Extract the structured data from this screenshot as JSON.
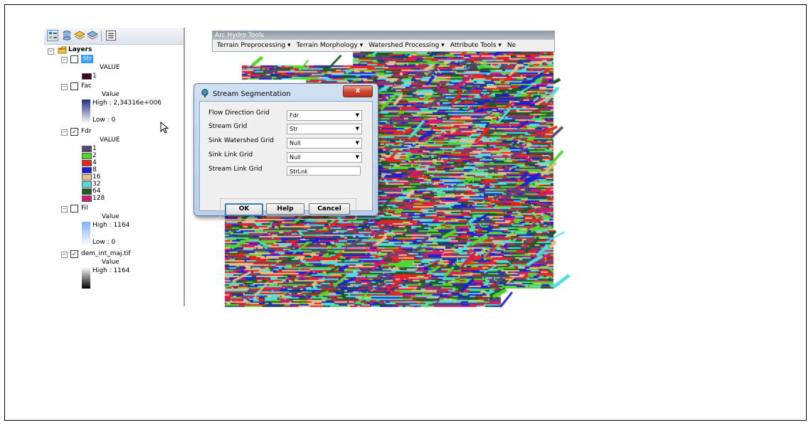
{
  "toc": {
    "root_label": "Layers",
    "layers": [
      {
        "name": "Str",
        "checked": false,
        "selected": true,
        "legend_header": "VALUE",
        "classes": [
          {
            "label": "1",
            "color": "#3d0a24"
          }
        ]
      },
      {
        "name": "Fac",
        "checked": false,
        "legend_header": "Value",
        "high": "High : 2,34316e+006",
        "low": "Low : 0",
        "ramp_colors": [
          "#1c2f86",
          "#ffffff"
        ]
      },
      {
        "name": "Fdr",
        "checked": true,
        "legend_header": "VALUE",
        "classes": [
          {
            "label": "1",
            "color": "#5a4673"
          },
          {
            "label": "2",
            "color": "#55d62e"
          },
          {
            "label": "4",
            "color": "#e8251c"
          },
          {
            "label": "8",
            "color": "#1d1fd6"
          },
          {
            "label": "16",
            "color": "#e4c08a"
          },
          {
            "label": "32",
            "color": "#4fdde0"
          },
          {
            "label": "64",
            "color": "#1d5a24"
          },
          {
            "label": "128",
            "color": "#d11b6c"
          }
        ]
      },
      {
        "name": "Fil",
        "checked": false,
        "legend_header": "Value",
        "high": "High : 1164",
        "low": "Low : 0",
        "ramp_colors": [
          "#7fb0ff",
          "#ffffff"
        ]
      },
      {
        "name": "dem_int_maj.tif",
        "checked": true,
        "legend_header": "Value",
        "high": "High : 1164",
        "ramp_colors": [
          "#ffffff",
          "#000000"
        ]
      }
    ]
  },
  "toolbar": {
    "title": "Arc Hydro Tools",
    "menus": [
      "Terrain Preprocessing ▾",
      "Terrain Morphology ▾",
      "Watershed Processing ▾",
      "Attribute Tools ▾",
      "Ne"
    ]
  },
  "dialog": {
    "title": "Stream Segmentation",
    "close_label": "x",
    "fields": [
      {
        "label": "Flow Direction Grid",
        "value": "Fdr",
        "kind": "dropdown"
      },
      {
        "label": "Stream Grid",
        "value": "Str",
        "kind": "dropdown"
      },
      {
        "label": "Sink Watershed Grid",
        "value": "Null",
        "kind": "dropdown"
      },
      {
        "label": "Sink Link Grid",
        "value": "Null",
        "kind": "dropdown"
      },
      {
        "label": "Stream Link Grid",
        "value": "StrLnk",
        "kind": "text"
      }
    ],
    "ok_label": "OK",
    "help_label": "Help",
    "cancel_label": "Cancel"
  },
  "raster_palette": [
    "#e8251c",
    "#55d62e",
    "#1d1fd6",
    "#4fdde0",
    "#d11b6c",
    "#e4c08a",
    "#5a4673",
    "#1d5a24"
  ]
}
